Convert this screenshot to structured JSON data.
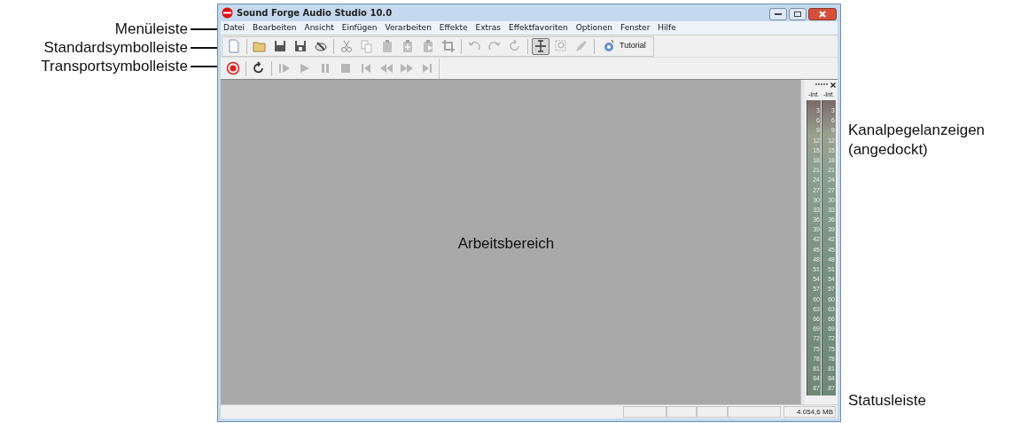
{
  "callouts_left": [
    "Menüleiste",
    "Standardsymbolleiste",
    "Transportsymbolleiste"
  ],
  "window": {
    "title": "Sound Forge Audio Studio 10.0"
  },
  "menu": [
    "Datei",
    "Bearbeiten",
    "Ansicht",
    "Einfügen",
    "Verarbeiten",
    "Effekte",
    "Extras",
    "Effektfavoriten",
    "Optionen",
    "Fenster",
    "Hilfe"
  ],
  "standard_toolbar": [
    {
      "kind": "new",
      "disabled": false,
      "pressed": false
    },
    {
      "kind": "sep"
    },
    {
      "kind": "open",
      "disabled": false,
      "pressed": false
    },
    {
      "kind": "save",
      "disabled": false,
      "pressed": false
    },
    {
      "kind": "saveas",
      "disabled": false,
      "pressed": false
    },
    {
      "kind": "render",
      "disabled": false,
      "pressed": false
    },
    {
      "kind": "sep"
    },
    {
      "kind": "cut",
      "disabled": true,
      "pressed": false
    },
    {
      "kind": "copy",
      "disabled": true,
      "pressed": false
    },
    {
      "kind": "paste",
      "disabled": true,
      "pressed": false
    },
    {
      "kind": "pastein",
      "disabled": true,
      "pressed": false
    },
    {
      "kind": "pastemix",
      "disabled": true,
      "pressed": false
    },
    {
      "kind": "crop",
      "disabled": true,
      "pressed": false
    },
    {
      "kind": "sep"
    },
    {
      "kind": "undo",
      "disabled": true,
      "pressed": false
    },
    {
      "kind": "redo",
      "disabled": true,
      "pressed": false
    },
    {
      "kind": "repeat",
      "disabled": true,
      "pressed": false
    },
    {
      "kind": "sep"
    },
    {
      "kind": "edit",
      "disabled": false,
      "pressed": true
    },
    {
      "kind": "magnify",
      "disabled": true,
      "pressed": false
    },
    {
      "kind": "pencil",
      "disabled": true,
      "pressed": false
    },
    {
      "kind": "sep"
    },
    {
      "kind": "tutorial",
      "label": "Tutorial",
      "disabled": false,
      "pressed": false
    }
  ],
  "transport_toolbar": [
    {
      "kind": "record",
      "disabled": false
    },
    {
      "kind": "sep"
    },
    {
      "kind": "loop",
      "disabled": false
    },
    {
      "kind": "sep"
    },
    {
      "kind": "playall",
      "disabled": true
    },
    {
      "kind": "play",
      "disabled": true
    },
    {
      "kind": "pause",
      "disabled": true
    },
    {
      "kind": "stop",
      "disabled": true
    },
    {
      "kind": "start",
      "disabled": true
    },
    {
      "kind": "rewind",
      "disabled": true
    },
    {
      "kind": "forward",
      "disabled": true
    },
    {
      "kind": "end",
      "disabled": true
    }
  ],
  "workspace": {
    "label": "Arbeitsbereich"
  },
  "meters": {
    "channels": [
      {
        "peak": "-Inf.",
        "scale": [
          "3",
          "6",
          "9",
          "12",
          "15",
          "18",
          "21",
          "24",
          "27",
          "30",
          "33",
          "36",
          "39",
          "42",
          "45",
          "48",
          "51",
          "54",
          "57",
          "60",
          "63",
          "66",
          "69",
          "72",
          "75",
          "78",
          "81",
          "84",
          "87"
        ]
      },
      {
        "peak": "-Inf.",
        "scale": [
          "3",
          "6",
          "9",
          "12",
          "15",
          "18",
          "21",
          "24",
          "27",
          "30",
          "33",
          "36",
          "39",
          "42",
          "45",
          "48",
          "51",
          "54",
          "57",
          "60",
          "63",
          "66",
          "69",
          "72",
          "75",
          "78",
          "81",
          "84",
          "87"
        ]
      }
    ]
  },
  "status_bar": {
    "memory": "4.054,6 MB"
  },
  "callouts_right": {
    "meters": "Kanalpegelanzeigen (angedockt)",
    "status": "Statusleiste"
  }
}
